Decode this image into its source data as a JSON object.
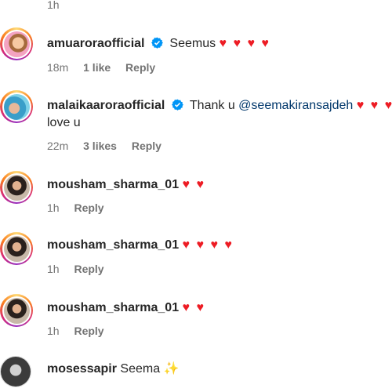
{
  "top_time": "1h",
  "comments": [
    {
      "username": "amuarora​official",
      "verified": true,
      "text": "Seemus",
      "hearts": "♥ ♥ ♥ ♥",
      "time": "18m",
      "likes": "1 like",
      "reply": "Reply"
    },
    {
      "username": "malaikaarora​official",
      "verified": true,
      "text": "Thank u",
      "mention": "@seemakiransajdeh",
      "hearts": "♥ ♥ ♥",
      "continuation": "love u",
      "time": "22m",
      "likes": "3 likes",
      "reply": "Reply"
    },
    {
      "username": "mousham_sharma_01",
      "hearts": "♥ ♥",
      "time": "1h",
      "reply": "Reply"
    },
    {
      "username": "mousham_sharma_01",
      "hearts": "♥ ♥ ♥ ♥",
      "time": "1h",
      "reply": "Reply"
    },
    {
      "username": "mousham_sharma_01",
      "hearts": "♥ ♥",
      "time": "1h",
      "reply": "Reply"
    },
    {
      "username": "mosessapir",
      "text": "Seema",
      "sparkle": "✨"
    }
  ],
  "colors": {
    "heart": "#ed1c24",
    "verified": "#0095f6",
    "mention": "#00376b",
    "meta": "#737373"
  }
}
